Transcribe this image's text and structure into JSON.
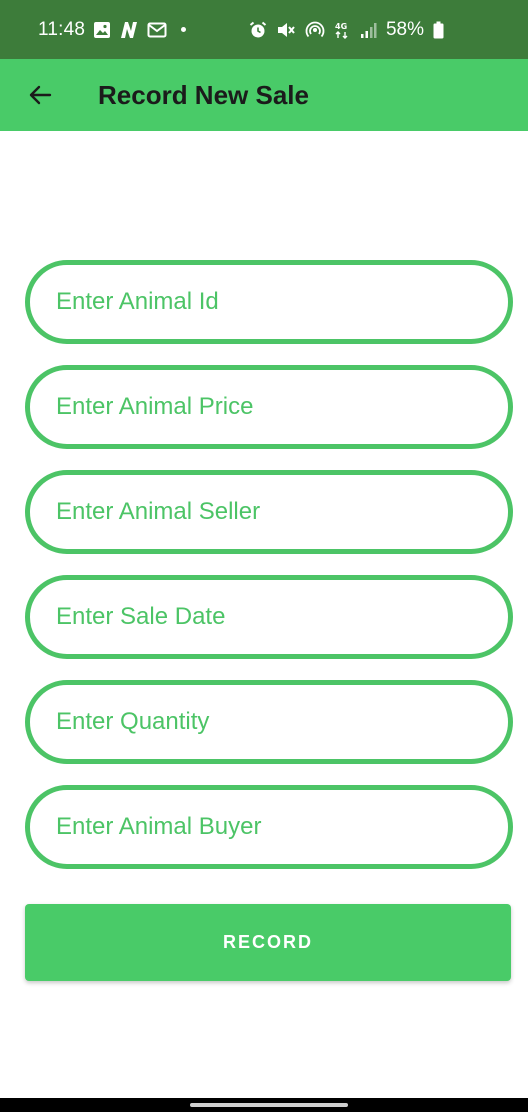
{
  "status_bar": {
    "time": "11:48",
    "battery": "58%",
    "network": "4G",
    "left_icons": [
      "image-icon",
      "n-app-icon",
      "mail-icon"
    ],
    "right_icons": [
      "alarm-icon",
      "mute-icon",
      "hotspot-icon",
      "network-icon",
      "signal-icon",
      "battery-icon"
    ]
  },
  "app_bar": {
    "title": "Record New Sale",
    "back_icon": "arrow-left-icon"
  },
  "form": {
    "fields": [
      {
        "placeholder": "Enter Animal Id",
        "value": ""
      },
      {
        "placeholder": "Enter Animal Price",
        "value": ""
      },
      {
        "placeholder": "Enter Animal Seller",
        "value": ""
      },
      {
        "placeholder": "Enter Sale Date",
        "value": ""
      },
      {
        "placeholder": "Enter Quantity",
        "value": ""
      },
      {
        "placeholder": "Enter Animal Buyer",
        "value": ""
      }
    ],
    "submit_label": "RECORD"
  },
  "colors": {
    "status_bar": "#3d7c3a",
    "accent": "#49cb68",
    "field_border": "#4cc466"
  }
}
